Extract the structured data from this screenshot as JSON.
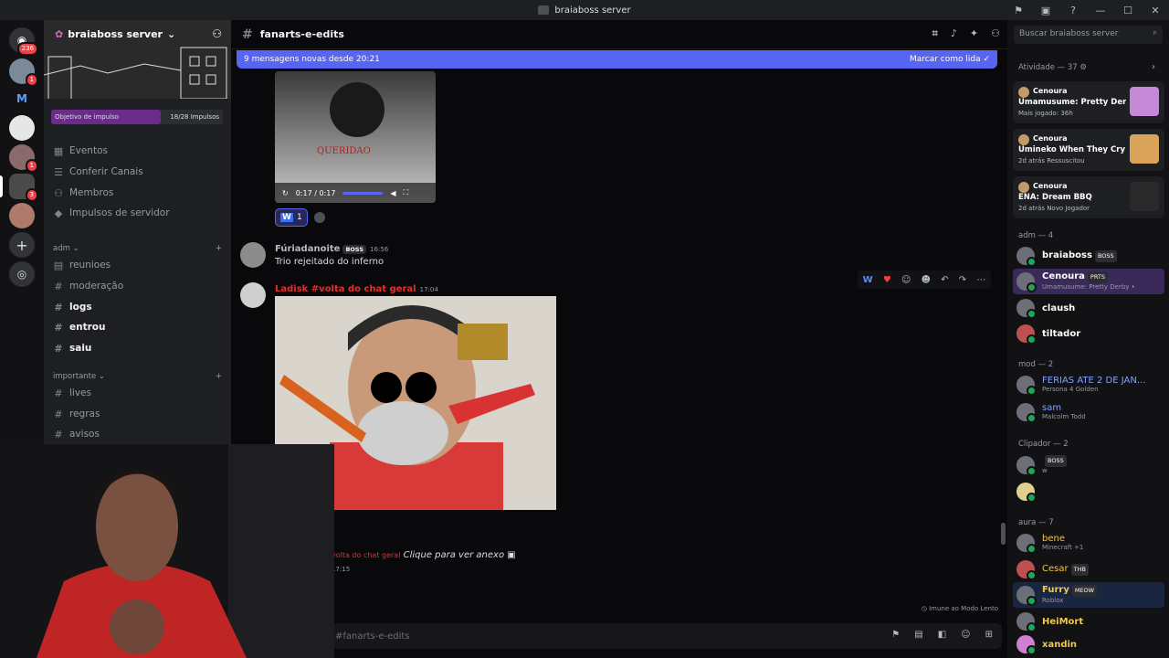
{
  "window": {
    "title": "braiaboss server",
    "controls": [
      "⚑",
      "▣",
      "?",
      "—",
      "☐",
      "✕"
    ]
  },
  "guilds": {
    "badges": [
      "236",
      "1",
      "1",
      "3"
    ],
    "logo_letter": "M"
  },
  "server": {
    "name": "braiaboss server",
    "boost": {
      "label": "Objetivo de impulso",
      "progress": "18/28 Impulsos"
    },
    "top_items": [
      "Eventos",
      "Conferir Canais",
      "Membros",
      "Impulsos de servidor"
    ],
    "categories": [
      {
        "name": "adm",
        "channels": [
          {
            "name": "reunioes",
            "unread": false
          },
          {
            "name": "moderação",
            "unread": false
          },
          {
            "name": "logs",
            "unread": true
          },
          {
            "name": "entrou",
            "unread": true
          },
          {
            "name": "saiu",
            "unread": true
          }
        ]
      },
      {
        "name": "importante",
        "channels": [
          {
            "name": "lives",
            "unread": false
          },
          {
            "name": "regras",
            "unread": false
          },
          {
            "name": "avisos",
            "unread": false
          }
        ]
      }
    ]
  },
  "channel": {
    "name": "fanarts-e-edits",
    "new_messages_bar": {
      "text": "9 mensagens novas desde 20:21",
      "action": "Marcar como lida"
    },
    "composer_placeholder": "#fanarts-e-edits",
    "slowmode": "Imune ao Modo Lento"
  },
  "messages": {
    "video": {
      "overlay_text": "QUERIDAO",
      "time": "0:17 / 0:17",
      "reaction_count": "1",
      "reaction_emoji": "W"
    },
    "m1": {
      "author": "Fúriadanoite",
      "tag": "BOSS",
      "time": "16:56",
      "text": "Trio rejeitado do inferno"
    },
    "m2": {
      "author": "Ladisk #volta do chat geral",
      "time": "17:04"
    },
    "m3": {
      "author_fragment": "volta do chat geral",
      "text": "Clique para ver anexo",
      "time": "17:15"
    }
  },
  "members": {
    "search_placeholder": "Buscar braiaboss server",
    "activity_header": "Atividade — 37",
    "activities": [
      {
        "user": "Cenoura",
        "game": "Umamusume: Pretty Derby",
        "detail": "Mais jogado: 36h"
      },
      {
        "user": "Cenoura",
        "game": "Umineko When They Cry - ...",
        "detail": "2d atrás  Ressuscitou"
      },
      {
        "user": "Cenoura",
        "game": "ENA: Dream BBQ",
        "detail": "2d atrás  Novo Jogador"
      }
    ],
    "groups": [
      {
        "header": "adm — 4",
        "members": [
          {
            "name": "braiaboss",
            "tag": "BOSS",
            "status": "",
            "color": "#ffffff"
          },
          {
            "name": "Cenoura",
            "tag": "PRTS",
            "status": "Umamusume: Pretty Derby •",
            "color": "#ffffff"
          },
          {
            "name": "claush",
            "tag": "",
            "status": "",
            "color": "#ffffff"
          },
          {
            "name": "tiltador",
            "tag": "",
            "status": "",
            "color": "#ffffff"
          }
        ]
      },
      {
        "header": "mod — 2",
        "members": [
          {
            "name": "FERIAS ATE 2 DE JAN...",
            "tag": "",
            "status": "Persona 4 Golden",
            "color": "#7fa3ff"
          },
          {
            "name": "sam",
            "tag": "",
            "status": "Malcolm Todd",
            "color": "#7fa3ff"
          }
        ]
      },
      {
        "header": "Clipador — 2",
        "members": [
          {
            "name": "",
            "tag": "BOSS",
            "status": "w",
            "color": "#ffffff"
          },
          {
            "name": "",
            "tag": "",
            "status": "",
            "color": "#ffffff"
          }
        ]
      },
      {
        "header": "aura — 7",
        "members": [
          {
            "name": "bene",
            "tag": "",
            "status": "Minecraft +1",
            "color": "#f0c94a"
          },
          {
            "name": "Cesar",
            "tag": "THB",
            "status": "",
            "color": "#f0c94a"
          },
          {
            "name": "Furry",
            "tag": "MEOW",
            "status": "Roblox",
            "color": "#f0c94a"
          },
          {
            "name": "HeiMort",
            "tag": "",
            "status": "",
            "color": "#f0c94a"
          },
          {
            "name": "xandin",
            "tag": "",
            "status": "",
            "color": "#f0c94a"
          }
        ]
      }
    ]
  }
}
